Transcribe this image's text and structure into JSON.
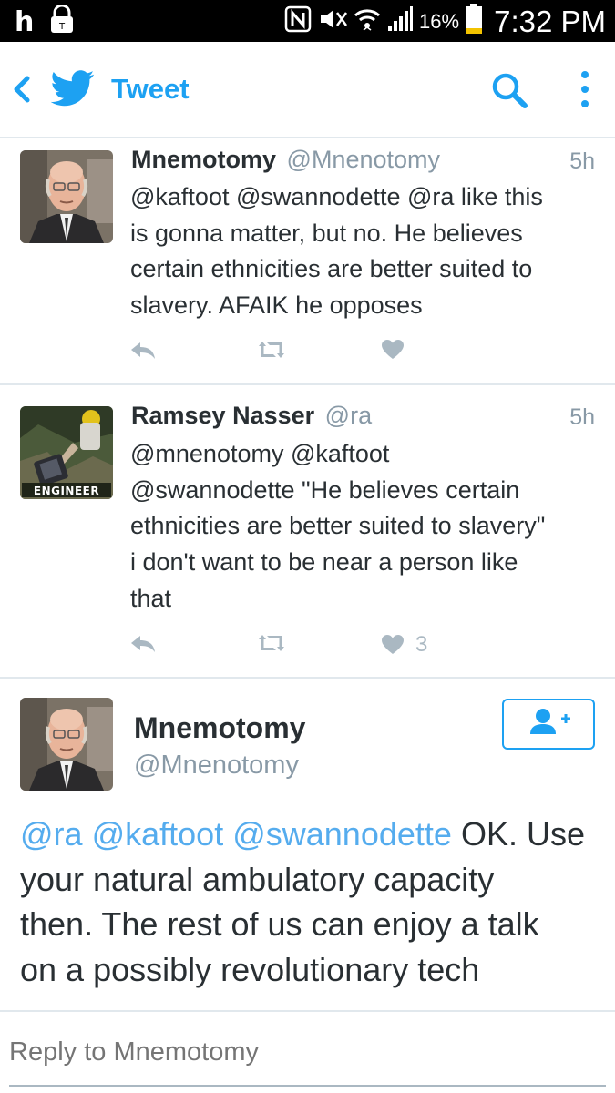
{
  "status_bar": {
    "battery_percent": "16%",
    "time": "7:32 PM"
  },
  "app_bar": {
    "title": "Tweet"
  },
  "tweets": [
    {
      "name": "Mnemotomy",
      "handle": "@Mnenotomy",
      "time": "5h",
      "lines": [
        "@kaftoot @swannodette @ra like this",
        "is gonna matter, but no. He believes",
        "certain ethnicities are better suited to",
        "slavery. AFAIK he opposes"
      ],
      "like_count": ""
    },
    {
      "name": "Ramsey Nasser",
      "handle": "@ra",
      "time": "5h",
      "avatar_label": "ENGINEER",
      "lines": [
        "@mnenotomy @kaftoot",
        "@swannodette \"He believes certain",
        "ethnicities are better suited to slavery\"",
        "i don't want to be near a person like",
        "that"
      ],
      "like_count": "3"
    }
  ],
  "detail": {
    "name": "Mnemotomy",
    "handle": "@Mnenotomy",
    "mentions": [
      "@ra",
      "@kaftoot",
      "@swannodette"
    ],
    "first_line_text": "OK. Use",
    "lines": [
      "your natural ambulatory capacity",
      "then. The rest of us can enjoy a talk",
      "on a possibly revolutionary tech"
    ]
  },
  "reply": {
    "placeholder": "Reply to Mnemotomy"
  },
  "colors": {
    "accent": "#1da1f2",
    "link": "#55acee",
    "muted": "#8899a6",
    "icon": "#aab8c2",
    "divider": "#e1e8ed"
  }
}
